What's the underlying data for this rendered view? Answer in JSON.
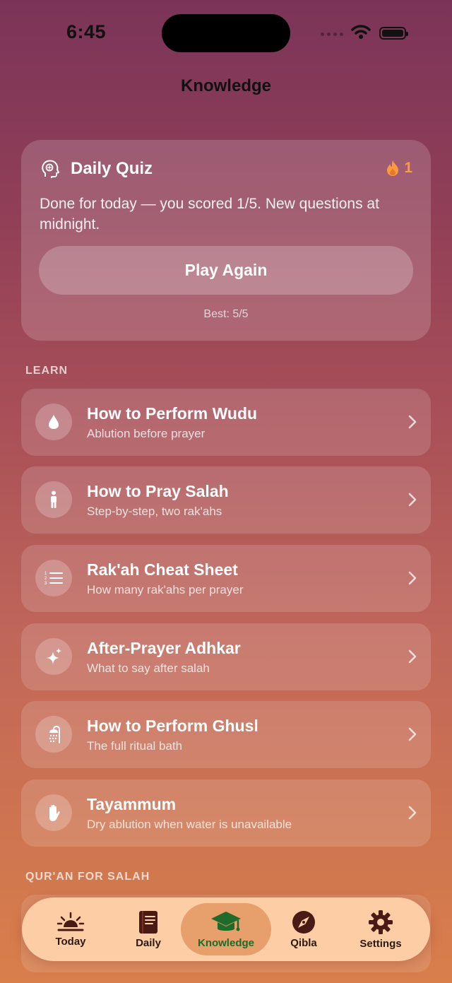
{
  "status_bar": {
    "time": "6:45"
  },
  "nav": {
    "title": "Knowledge"
  },
  "quiz": {
    "title": "Daily Quiz",
    "streak": "1",
    "message": "Done for today — you scored 1/5. New questions at midnight.",
    "play_label": "Play Again",
    "best": "Best: 5/5"
  },
  "sections": {
    "learn": "LEARN",
    "quran": "QUR'AN FOR SALAH"
  },
  "learn_items": [
    {
      "title": "How to Perform Wudu",
      "subtitle": "Ablution before prayer",
      "icon": "water-drop-icon"
    },
    {
      "title": "How to Pray Salah",
      "subtitle": "Step-by-step, two rak'ahs",
      "icon": "standing-person-icon"
    },
    {
      "title": "Rak'ah Cheat Sheet",
      "subtitle": "How many rak'ahs per prayer",
      "icon": "numbered-list-icon"
    },
    {
      "title": "After-Prayer Adhkar",
      "subtitle": "What to say after salah",
      "icon": "sparkles-icon"
    },
    {
      "title": "How to Perform Ghusl",
      "subtitle": "The full ritual bath",
      "icon": "shower-icon"
    },
    {
      "title": "Tayammum",
      "subtitle": "Dry ablution when water is unavailable",
      "icon": "hand-icon"
    }
  ],
  "tabs": [
    {
      "label": "Today",
      "icon": "sunrise-icon"
    },
    {
      "label": "Daily",
      "icon": "book-icon"
    },
    {
      "label": "Knowledge",
      "icon": "graduation-cap-icon",
      "active": true
    },
    {
      "label": "Qibla",
      "icon": "compass-icon"
    },
    {
      "label": "Settings",
      "icon": "gear-icon"
    }
  ],
  "colors": {
    "streak": "#ff9a3c",
    "active_tab": "#1e6b2a",
    "tab_icon": "#4a1a14"
  }
}
